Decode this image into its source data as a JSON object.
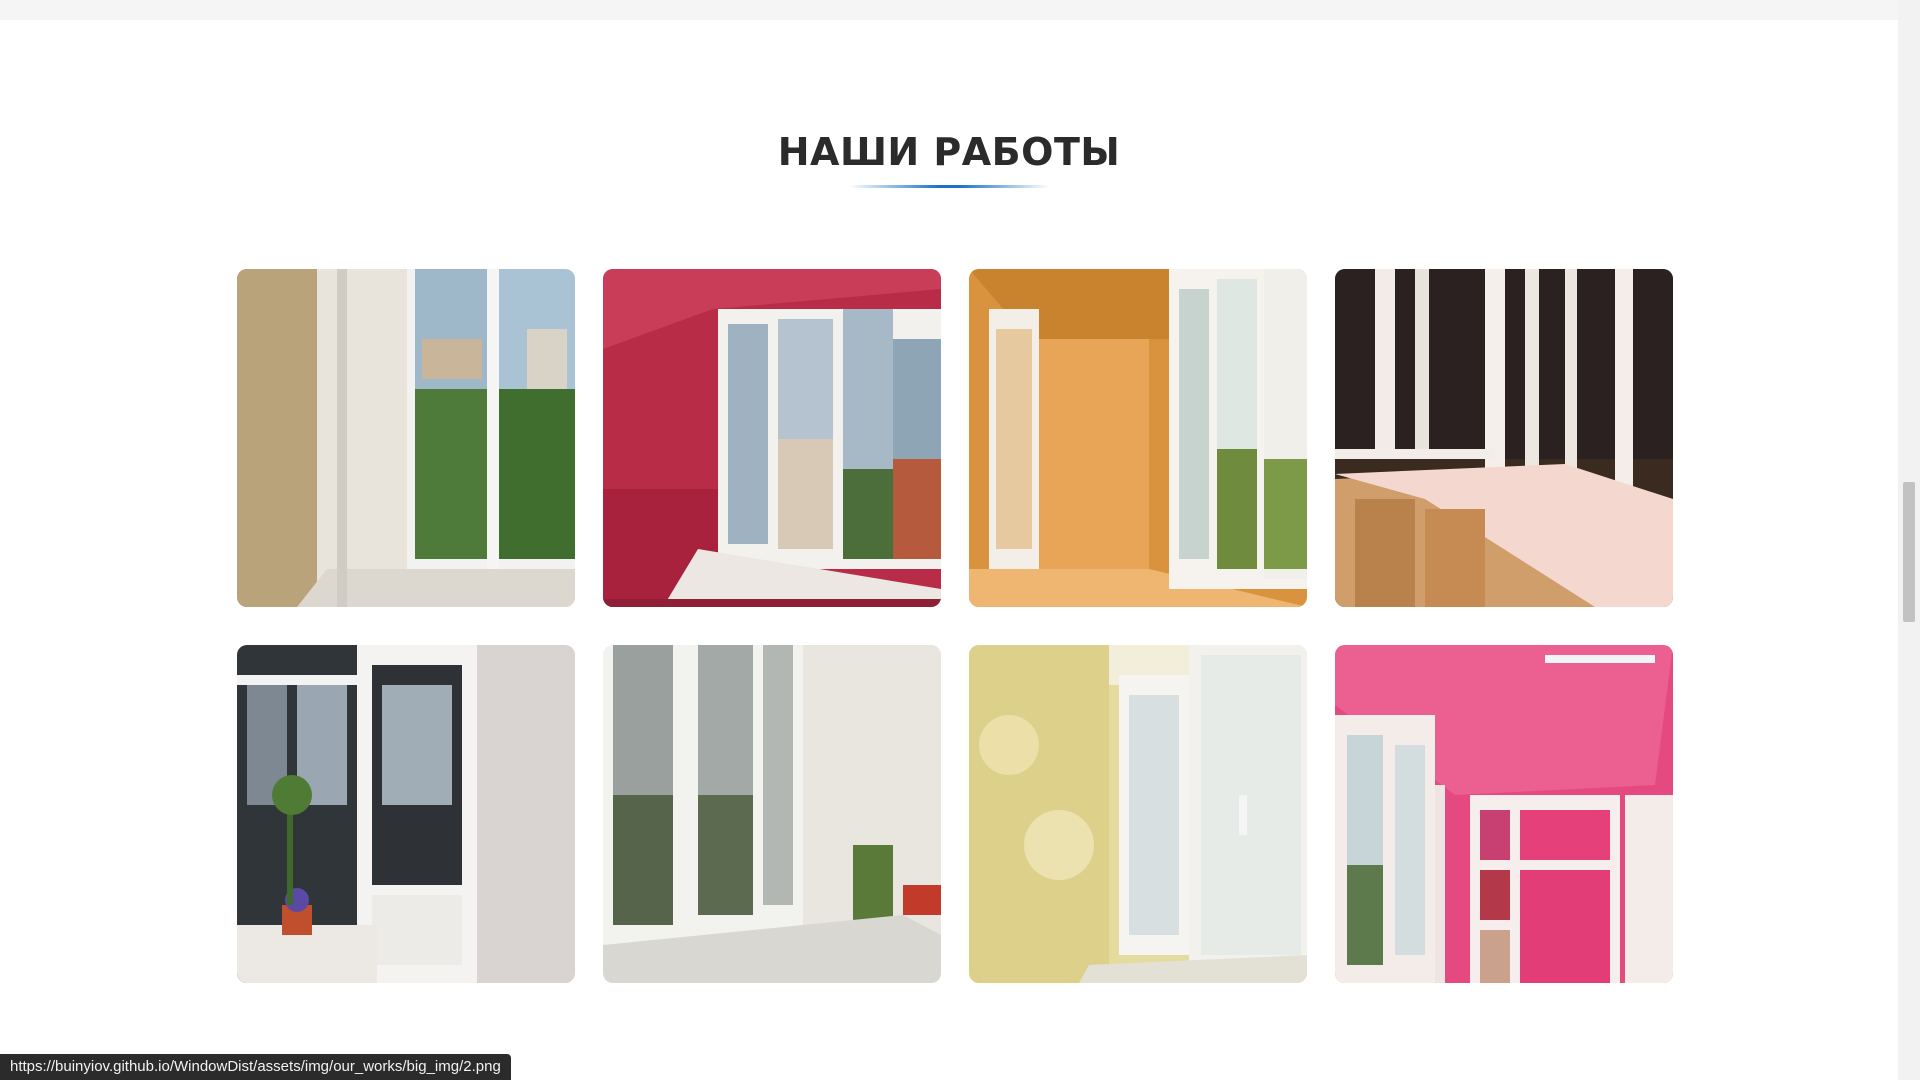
{
  "section": {
    "title": "НАШИ РАБОТЫ"
  },
  "gallery": {
    "items": [
      {
        "alt": "балкон 1"
      },
      {
        "alt": "балкон 2"
      },
      {
        "alt": "балкон 3"
      },
      {
        "alt": "балкон 4"
      },
      {
        "alt": "балкон 5"
      },
      {
        "alt": "балкон 6"
      },
      {
        "alt": "балкон 7"
      },
      {
        "alt": "балкон 8"
      }
    ]
  },
  "status_bar": {
    "url": "https://buinyiov.github.io/WindowDist/assets/img/our_works/big_img/2.png"
  },
  "colors": {
    "accent": "#1a73c4",
    "title": "#2b2b2b"
  }
}
